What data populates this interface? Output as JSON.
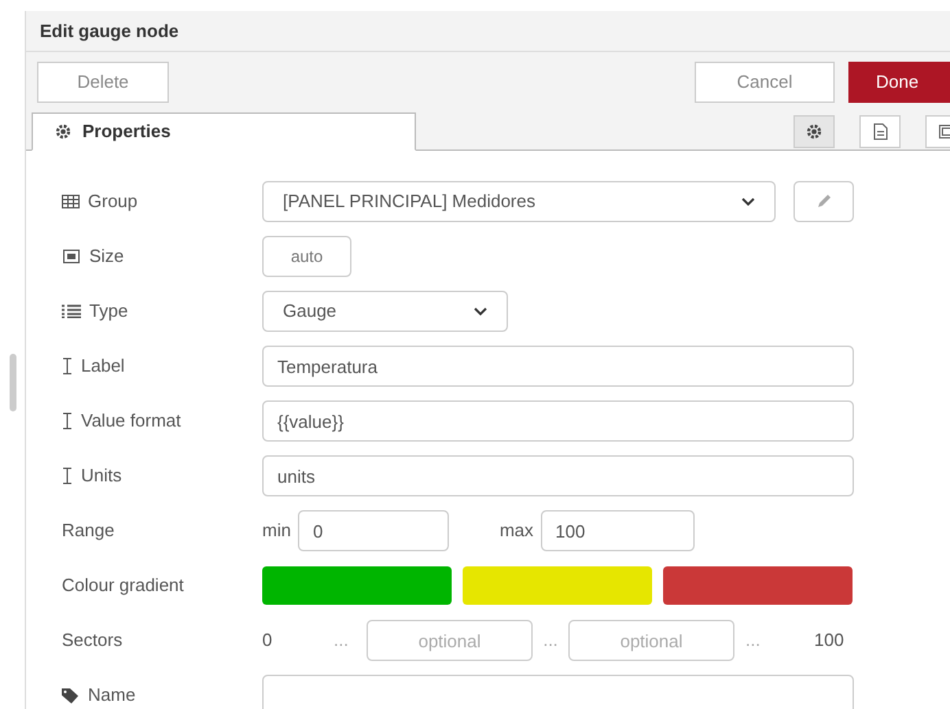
{
  "title": "Edit gauge node",
  "buttons": {
    "delete": "Delete",
    "cancel": "Cancel",
    "done": "Done"
  },
  "tabs": [
    {
      "label": "Properties",
      "selected": true
    }
  ],
  "tab_icons": [
    {
      "kind": "gear",
      "selected": true
    },
    {
      "kind": "document",
      "selected": false
    },
    {
      "kind": "frame",
      "selected": false
    }
  ],
  "fields": [
    {
      "kind": "select",
      "label": "Group",
      "value": "[PANEL PRINCIPAL] Medidores"
    },
    {
      "kind": "size",
      "label": "Size",
      "value": "auto"
    },
    {
      "kind": "select-short",
      "label": "Type",
      "value": "Gauge"
    },
    {
      "kind": "text",
      "label": "Label",
      "value": "Temperatura"
    },
    {
      "kind": "text",
      "label": "Value format",
      "value": "{{value}}"
    },
    {
      "kind": "text",
      "label": "Units",
      "value": "units"
    }
  ],
  "range": {
    "label": "Range",
    "min_label": "min",
    "min": "0",
    "max_label": "max",
    "max": "100"
  },
  "gradient": {
    "label": "Colour gradient",
    "colors": [
      {
        "color": "#00b500"
      },
      {
        "color": "#e6e600"
      },
      {
        "color": "#ca3838"
      }
    ]
  },
  "sectors": {
    "label": "Sectors",
    "start": "0",
    "sep_1": "...",
    "placeholder_1": "optional",
    "sep_2": "...",
    "placeholder_2": "optional",
    "sep_3": "...",
    "end": "100"
  },
  "name": {
    "label": "Name"
  }
}
